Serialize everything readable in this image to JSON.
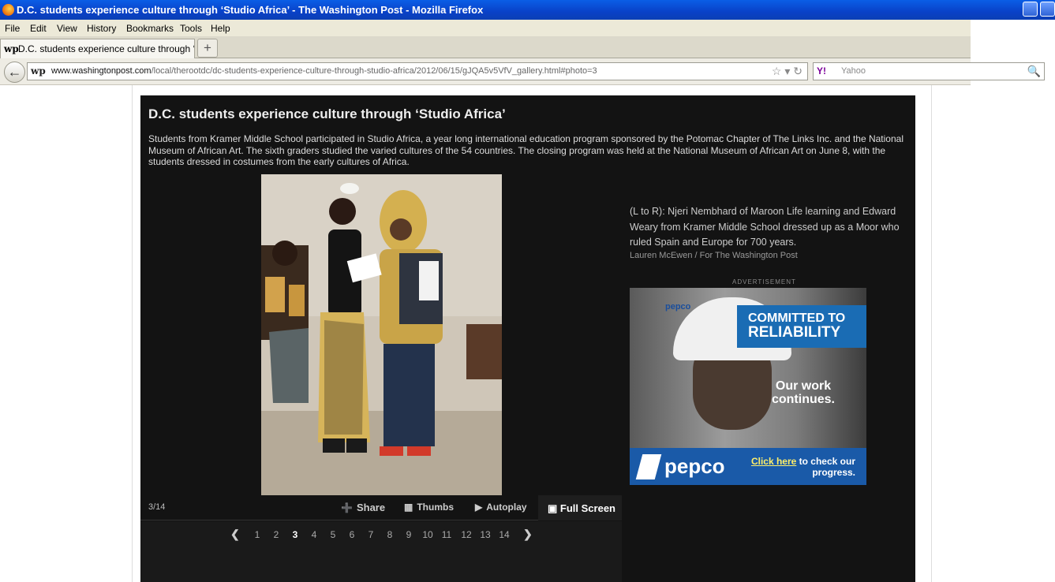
{
  "window": {
    "title": "D.C. students experience culture through ‘Studio Africa’ - The Washington Post - Mozilla Firefox"
  },
  "menu": {
    "items": [
      "File",
      "Edit",
      "View",
      "History",
      "Bookmarks",
      "Tools",
      "Help"
    ]
  },
  "tab": {
    "favicon": "wp",
    "label": "D.C. students experience culture through ‘S...",
    "new_tab": "+"
  },
  "nav": {
    "site_icon": "wp",
    "url_domain": "www.washingtonpost.com",
    "url_path": "/local/therootdc/dc-students-experience-culture-through-studio-africa/2012/06/15/gJQA5v5VfV_gallery.html#photo=3",
    "search_engine": "Y!",
    "search_placeholder": "Yahoo"
  },
  "gallery": {
    "title": "D.C. students experience culture through ‘Studio Africa’",
    "description": "Students from Kramer Middle School participated in Studio Africa, a year long international education program sponsored by the Potomac Chapter of The Links Inc. and the National Museum of African Art. The sixth graders studied the varied cultures of the 54 countries. The closing program was held at the National Museum of African Art on June 8, with the students dressed in costumes from the early cultures of Africa.",
    "caption": "(L to R): Njeri Nembhard of Maroon Life learning and Edward Weary from Kramer Middle School dressed up as a Moor who ruled Spain and Europe for 700 years.",
    "credit": "Lauren McEwen / For The Washington Post",
    "counter": "3/14",
    "controls": {
      "share": "Share",
      "thumbs": "Thumbs",
      "autoplay": "Autoplay",
      "fullscreen": "Full Screen"
    },
    "pages": [
      "1",
      "2",
      "3",
      "4",
      "5",
      "6",
      "7",
      "8",
      "9",
      "10",
      "11",
      "12",
      "13",
      "14"
    ],
    "current_page": "3"
  },
  "ad": {
    "label": "ADVERTISEMENT",
    "logo_small": "pepco",
    "headline_1": "COMMITTED TO",
    "headline_2": "RELIABILITY",
    "tagline_1": "Our work",
    "tagline_2": "continues.",
    "brand": "pepco",
    "cta_link": "Click here",
    "cta_rest": " to check our progress."
  }
}
